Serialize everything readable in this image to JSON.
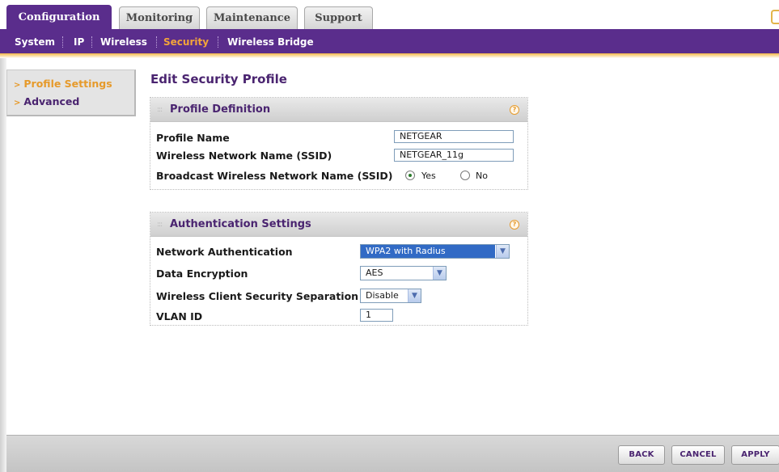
{
  "tabs": [
    {
      "label": "Configuration",
      "active": true
    },
    {
      "label": "Monitoring",
      "active": false
    },
    {
      "label": "Maintenance",
      "active": false
    },
    {
      "label": "Support",
      "active": false
    }
  ],
  "subnav": {
    "items": [
      {
        "label": "System",
        "active": false
      },
      {
        "label": "IP",
        "active": false
      },
      {
        "label": "Wireless",
        "active": false
      },
      {
        "label": "Security",
        "active": true
      },
      {
        "label": "Wireless Bridge",
        "active": false
      }
    ]
  },
  "leftnav": {
    "items": [
      {
        "label": "Profile Settings",
        "active": true
      },
      {
        "label": "Advanced",
        "active": false
      }
    ]
  },
  "page_title": "Edit Security Profile",
  "profile_definition": {
    "title": "Profile Definition",
    "help_icon": "?",
    "profile_name_label": "Profile Name",
    "profile_name_value": "NETGEAR",
    "ssid_label": "Wireless Network Name (SSID)",
    "ssid_value": "NETGEAR_11g",
    "broadcast_label": "Broadcast Wireless Network Name (SSID)",
    "broadcast_yes": "Yes",
    "broadcast_no": "No",
    "broadcast_selected": "Yes"
  },
  "authentication": {
    "title": "Authentication Settings",
    "help_icon": "?",
    "network_auth_label": "Network Authentication",
    "network_auth_value": "WPA2 with Radius",
    "data_encryption_label": "Data Encryption",
    "data_encryption_value": "AES",
    "separation_label": "Wireless Client Security Separation",
    "separation_value": "Disable",
    "vlan_label": "VLAN ID",
    "vlan_value": "1"
  },
  "footer": {
    "back_label": "BACK",
    "cancel_label": "CANCEL",
    "apply_label": "APPLY"
  },
  "colors": {
    "brand_purple": "#5a2d8c",
    "accent_orange": "#f3a43a",
    "selection_blue": "#316ac5"
  }
}
